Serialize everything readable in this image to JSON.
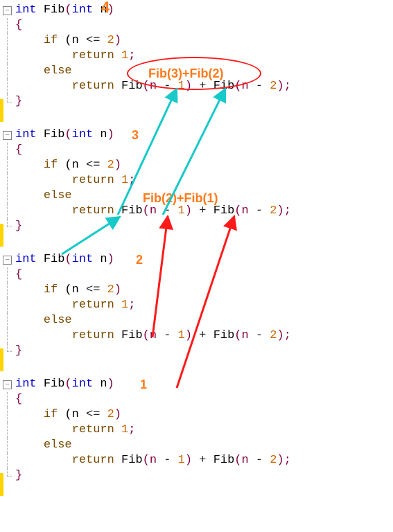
{
  "annotations": {
    "n4": "4",
    "n3": "3",
    "n2": "2",
    "n1": "1",
    "fib32": "Fib(3)+Fib(2)",
    "fib21": "Fib(2)+Fib(1)"
  },
  "code": {
    "fn_sig_open": "int ",
    "fn_name": "Fib",
    "fn_sig_mid": "(",
    "fn_param_type": "int",
    "fn_param_name": " n",
    "fn_sig_close": ")",
    "brace_open": "{",
    "if_kw": "if",
    "if_cond_open": " (n ",
    "if_op": "<=",
    "if_val": " 2",
    "if_cond_close": ")",
    "ret_kw": "return",
    "ret1_val": " 1",
    "semicolon": ";",
    "else_kw": "else",
    "ret2_call1": " Fib",
    "ret2_arg1_open": "(n ",
    "ret2_arg1_op": "-",
    "ret2_arg1_val": " 1",
    "ret2_arg1_close": ")",
    "plus": " + ",
    "ret2_call2": "Fib",
    "ret2_arg2_open": "(n ",
    "ret2_arg2_op": "-",
    "ret2_arg2_val": " 2",
    "ret2_arg2_close": ")",
    "brace_close": "}"
  }
}
